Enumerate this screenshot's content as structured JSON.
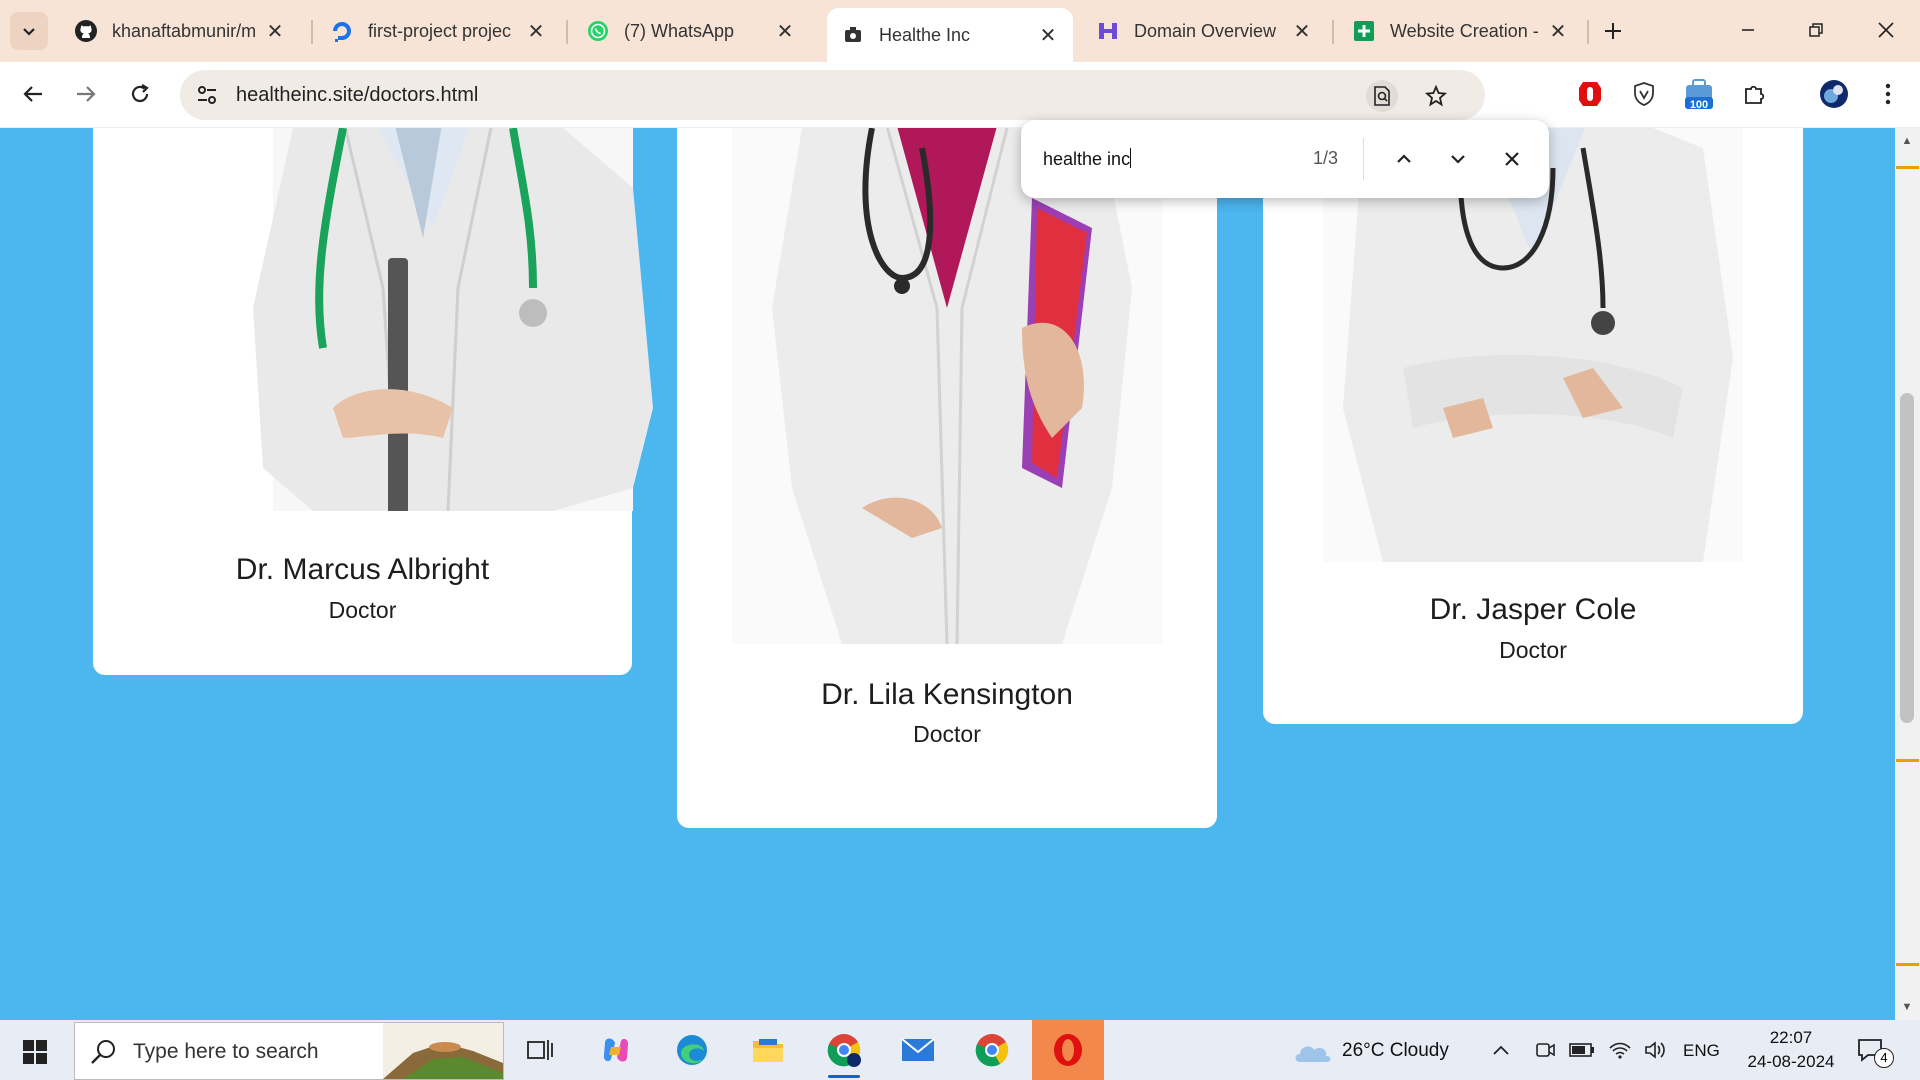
{
  "browser": {
    "tabs": [
      {
        "title": "khanaftabmunir/m",
        "icon": "github-icon"
      },
      {
        "title": "first-project projec",
        "icon": "digitalocean-icon"
      },
      {
        "title": "(7) WhatsApp",
        "icon": "whatsapp-icon"
      },
      {
        "title": "Healthe Inc",
        "icon": "site-favicon-icon",
        "active": true
      },
      {
        "title": "Domain Overview",
        "icon": "semrush-icon"
      },
      {
        "title": "Website Creation -",
        "icon": "google-sheets-icon"
      }
    ],
    "url": "healtheinc.site/doctors.html",
    "extension_badge": "100"
  },
  "find_bar": {
    "query": "healthe inc",
    "count": "1/3"
  },
  "doctors": [
    {
      "name": "Dr. Marcus Albright",
      "role": "Doctor"
    },
    {
      "name": "Dr. Lila Kensington",
      "role": "Doctor"
    },
    {
      "name": "Dr. Jasper Cole",
      "role": "Doctor"
    }
  ],
  "taskbar": {
    "search_placeholder": "Type here to search",
    "weather": "26°C  Cloudy",
    "language": "ENG",
    "time": "22:07",
    "date": "24-08-2024",
    "notifications": "4"
  },
  "colors": {
    "page_background": "#4cb6ef",
    "tab_strip": "#f8e4d6",
    "card": "#ffffff"
  }
}
